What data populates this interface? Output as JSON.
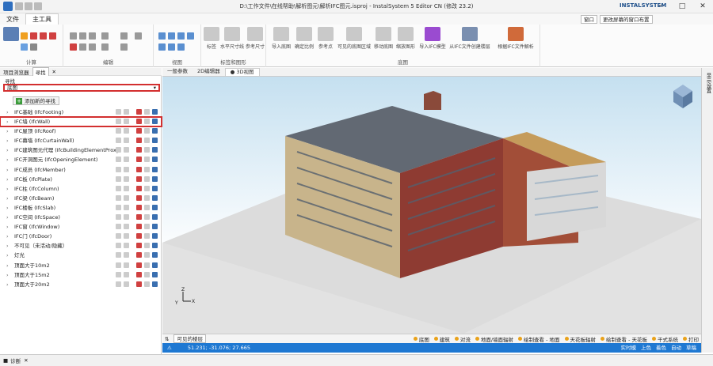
{
  "titlebar": {
    "title": "D:\\工作文件\\在线帮助\\解析图元\\解析IFC图元.isproj - InstalSystem 5 Editor CN (修改 23.2)"
  },
  "menu": {
    "file": "文件",
    "main": "主工具"
  },
  "right": {
    "window": "窗口",
    "layout": "更改屏幕的窗口布置",
    "brand": "INSTALSYSTEM"
  },
  "ribbon": {
    "groups": {
      "calc": "计算",
      "edit": "编辑",
      "view": "视图",
      "mark": "标签和图形",
      "base": "底图"
    },
    "mark_buttons": [
      "标签",
      "水平尺寸线",
      "参考尺寸"
    ],
    "base_buttons": [
      "导入底图",
      "确定比例",
      "参考点",
      "可见的底图区域",
      "移动底图",
      "缩放图形",
      "导入IFC模型",
      "从IFC文件创建楼层",
      "根据IFC文件解析"
    ]
  },
  "panel": {
    "tab_browser": "项目浏览器",
    "tab_find": "寻找",
    "label": "寻找",
    "select": "底图",
    "add": "添加新的寻找",
    "rows": [
      {
        "label": "IFC基础 (IfcFooting)",
        "arrow": true
      },
      {
        "label": "IFC墙 (IfcWall)",
        "arrow": true,
        "hl": true
      },
      {
        "label": "IFC屋顶 (IfcRoof)",
        "arrow": true
      },
      {
        "label": "IFC幕墙 (IfcCurtainWall)",
        "arrow": true
      },
      {
        "label": "IFC建筑图元代理 (IfcBuildingElementProxy)",
        "arrow": true
      },
      {
        "label": "IFC开洞图元 (IfcOpeningElement)",
        "arrow": true
      },
      {
        "label": "IFC成员 (IfcMember)",
        "arrow": true
      },
      {
        "label": "IFC板 (IfcPlate)",
        "arrow": true
      },
      {
        "label": "IFC柱 (IfcColumn)",
        "arrow": true
      },
      {
        "label": "IFC梁 (IfcBeam)",
        "arrow": true
      },
      {
        "label": "IFC楼板 (IfcSlab)",
        "arrow": true
      },
      {
        "label": "IFC空间 (IfcSpace)",
        "arrow": true
      },
      {
        "label": "IFC窗 (IfcWindow)",
        "arrow": true
      },
      {
        "label": "IFC门 (IfcDoor)",
        "arrow": true
      },
      {
        "label": "不可见（未活动/隐藏）",
        "arrow": true
      },
      {
        "label": "灯光",
        "arrow": true
      },
      {
        "label": "顶面大于10m2",
        "arrow": true
      },
      {
        "label": "顶面大于15m2",
        "arrow": true
      },
      {
        "label": "顶面大于20m2",
        "arrow": true
      }
    ]
  },
  "tabs": [
    "一般参数",
    "2D编辑器",
    "● 3D视图"
  ],
  "bottombar": {
    "visible_floors": "可见的楼层",
    "items": [
      "底图",
      "建筑",
      "对流",
      "地面/墙面辐射",
      "绘制查看 - 地面",
      "天花板辐射",
      "绘制查看 - 天花板",
      "干式系统",
      "打印"
    ]
  },
  "status": {
    "coords": "51.231; -31.076; 27.665",
    "right": [
      "实时模",
      "上色",
      "着色",
      "自动",
      "草稿"
    ]
  },
  "sidebar": {
    "label": "显示设置"
  },
  "footer": {
    "diag": "诊断"
  },
  "axis": {
    "x": "X",
    "y": "Y",
    "z": "Z"
  }
}
